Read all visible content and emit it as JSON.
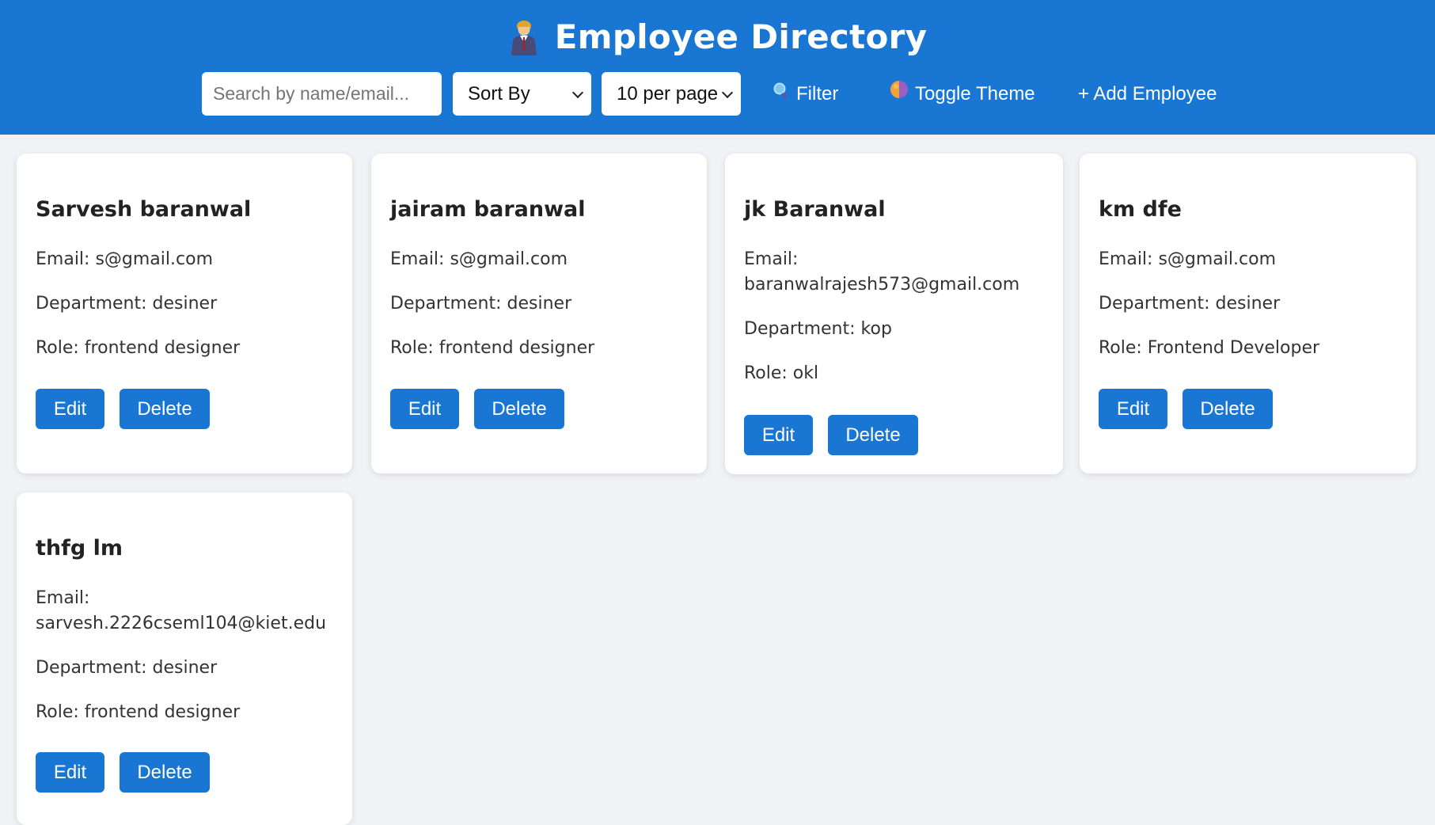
{
  "header": {
    "title": "Employee Directory",
    "title_icon": "office-worker-icon",
    "background_color": "#1976d2"
  },
  "controls": {
    "search_placeholder": "Search by name/email...",
    "search_value": "",
    "sort_selected": "Sort By",
    "page_size_selected": "10 per page",
    "filter_label": "Filter",
    "filter_icon": "magnifier-icon",
    "toggle_theme_label": "Toggle Theme",
    "toggle_theme_icon": "theme-orb-icon",
    "add_employee_label": "+ Add Employee"
  },
  "employees": [
    {
      "name": "Sarvesh baranwal",
      "email_label": "Email:",
      "email": "s@gmail.com",
      "department": "Department: desiner",
      "role": "Role: frontend designer",
      "edit_label": "Edit",
      "delete_label": "Delete"
    },
    {
      "name": "jairam baranwal",
      "email_label": "Email:",
      "email": "s@gmail.com",
      "department": "Department: desiner",
      "role": "Role: frontend designer",
      "edit_label": "Edit",
      "delete_label": "Delete"
    },
    {
      "name": "jk Baranwal",
      "email_label": "Email:",
      "email": "baranwalrajesh573@gmail.com",
      "department": "Department: kop",
      "role": "Role: okl",
      "edit_label": "Edit",
      "delete_label": "Delete"
    },
    {
      "name": "km dfe",
      "email_label": "Email:",
      "email": "s@gmail.com",
      "department": "Department: desiner",
      "role": "Role: Frontend Developer",
      "edit_label": "Edit",
      "delete_label": "Delete"
    },
    {
      "name": "thfg lm",
      "email_label": "Email:",
      "email": "sarvesh.2226cseml104@kiet.edu",
      "department": "Department: desiner",
      "role": "Role: frontend designer",
      "edit_label": "Edit",
      "delete_label": "Delete"
    }
  ]
}
